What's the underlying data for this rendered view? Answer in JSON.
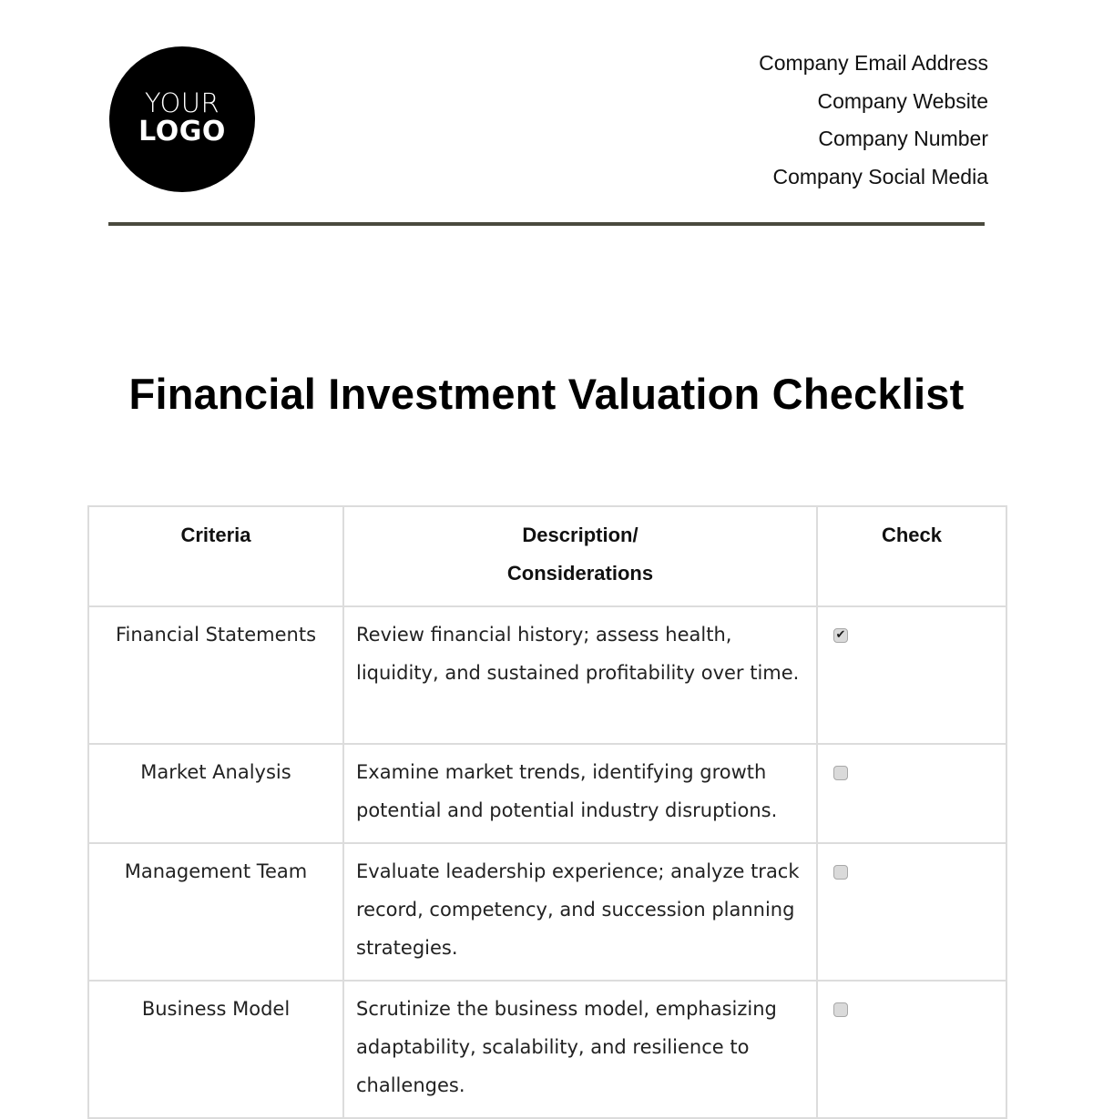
{
  "logo": {
    "line1": "YOUR",
    "line2": "LOGO"
  },
  "contact": {
    "email": "Company Email Address",
    "website": "Company Website",
    "number": "Company Number",
    "social": "Company Social Media"
  },
  "title": "Financial Investment Valuation Checklist",
  "table": {
    "headers": {
      "criteria": "Criteria",
      "description_line1": "Description/",
      "description_line2": "Considerations",
      "check": "Check"
    },
    "rows": [
      {
        "criteria": "Financial Statements",
        "description": "Review financial history; assess health, liquidity, and sustained profitability over time.",
        "checked": true,
        "check_glyph": "✔"
      },
      {
        "criteria": "Market Analysis",
        "description": "Examine market trends, identifying growth potential and potential industry disruptions.",
        "checked": false,
        "check_glyph": ""
      },
      {
        "criteria": "Management Team",
        "description": "Evaluate leadership experience; analyze track record, competency, and succession planning strategies.",
        "checked": false,
        "check_glyph": ""
      },
      {
        "criteria": "Business Model",
        "description": "Scrutinize the business model, emphasizing adaptability, scalability, and resilience to challenges.",
        "checked": false,
        "check_glyph": ""
      }
    ]
  }
}
